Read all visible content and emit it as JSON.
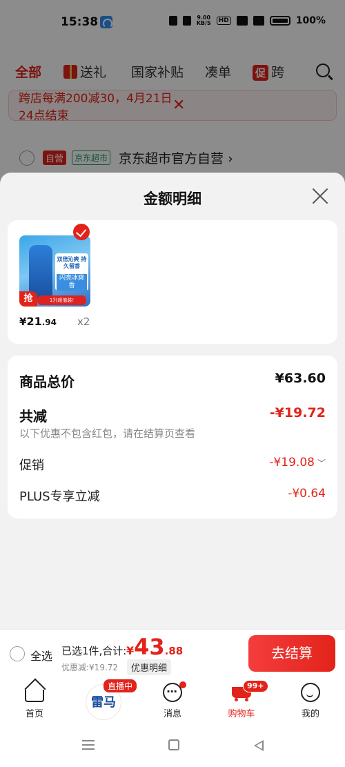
{
  "status_bar": {
    "time": "15:38",
    "net_speed_top": "9.00",
    "net_speed_bottom": "KB/S",
    "hd": "HD",
    "battery": "100%"
  },
  "background": {
    "tabs": [
      "全部",
      "送礼",
      "国家补贴",
      "凑单",
      "跨"
    ],
    "promo_tag": "促",
    "notice": "跨店每满200减30，4月21日24点结束",
    "shop": {
      "badge_self": "自营",
      "badge_market": "京东超市",
      "name": "京东超市官方自营",
      "chevron": "›"
    }
  },
  "sheet": {
    "title": "金额明细",
    "product": {
      "promo_line1": "双倍沁爽 持久留香",
      "promo_line2": "闪亮冰爽香",
      "grab_label": "抢",
      "strip_text": "1升超值装!",
      "price_currency": "¥",
      "price_int": "21",
      "price_dec": ".94",
      "quantity": "x2"
    },
    "summary": {
      "total_label": "商品总价",
      "total_value": "¥63.60",
      "reduce_label": "共减",
      "reduce_value": "-¥19.72",
      "note": "以下优惠不包含红包，请在结算页查看",
      "promo_label": "促销",
      "promo_value": "-¥19.08",
      "plus_label": "PLUS专享立减",
      "plus_value": "-¥0.64"
    }
  },
  "checkout": {
    "select_all": "全选",
    "selected_info": "已选1件,合计:",
    "total_currency": "¥",
    "total_int": "43",
    "total_dec": ".88",
    "discount_text": "优惠减:¥19.72",
    "detail_button": "优惠明细",
    "pay_button": "去结算"
  },
  "nav": {
    "home": "首页",
    "live_logo": "雷马",
    "live_badge": "直播中",
    "messages": "消息",
    "cart": "购物车",
    "cart_badge": "99+",
    "me": "我的"
  },
  "colors": {
    "accent": "#e2231a",
    "green": "#1e9e62",
    "sheet_bg": "#f2f2f2"
  }
}
